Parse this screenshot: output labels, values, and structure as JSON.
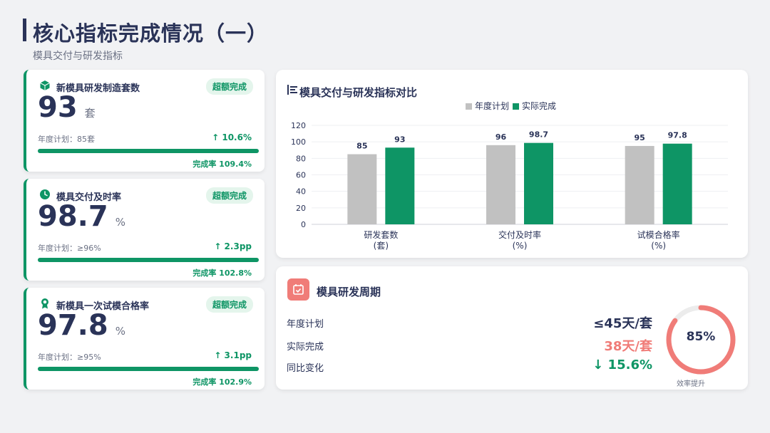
{
  "page": {
    "title": "核心指标完成情况（一）",
    "subtitle": "模具交付与研发指标"
  },
  "colors": {
    "primary": "#2a3358",
    "green": "#0e9565",
    "gray_bar": "#c1c1c1",
    "red": "#f07c78"
  },
  "kpi_cards": [
    {
      "icon": "cube-icon",
      "label": "新模具研发制造套数",
      "badge": "超额完成",
      "value": "93",
      "unit": "套",
      "plan": "年度计划：85套",
      "change": "↑ 10.6%",
      "rate_label": "完成率 109.4%",
      "progress": 1.0
    },
    {
      "icon": "clock-icon",
      "label": "模具交付及时率",
      "badge": "超额完成",
      "value": "98.7",
      "unit": "%",
      "plan": "年度计划：≥96%",
      "change": "↑ 2.3pp",
      "rate_label": "完成率 102.8%",
      "progress": 1.0
    },
    {
      "icon": "award-icon",
      "label": "新模具一次试模合格率",
      "badge": "超额完成",
      "value": "97.8",
      "unit": "%",
      "plan": "年度计划：≥95%",
      "change": "↑ 3.1pp",
      "rate_label": "完成率 102.9%",
      "progress": 1.0
    }
  ],
  "chart_data": {
    "type": "bar",
    "title": "模具交付与研发指标对比",
    "categories": [
      [
        "研发套数",
        "(套)"
      ],
      [
        "交付及时率",
        "(%)"
      ],
      [
        "试模合格率",
        "(%)"
      ]
    ],
    "series": [
      {
        "name": "年度计划",
        "values": [
          85,
          96,
          95
        ],
        "color": "#c1c1c1"
      },
      {
        "name": "实际完成",
        "values": [
          93,
          98.7,
          97.8
        ],
        "color": "#0e9565"
      }
    ],
    "value_labels": [
      [
        "85",
        "96",
        "95"
      ],
      [
        "93",
        "98.7",
        "97.8"
      ]
    ],
    "ylim": [
      0,
      120
    ],
    "yticks": [
      0,
      20,
      40,
      60,
      80,
      100,
      120
    ],
    "grid": true,
    "legend": "top-center"
  },
  "cycle": {
    "title": "模具研发周期",
    "rows": [
      {
        "label": "年度计划",
        "value": "≤45天/套",
        "color": "#2a3358"
      },
      {
        "label": "实际完成",
        "value": "38天/套",
        "color": "#f07c78"
      },
      {
        "label": "同比变化",
        "value": "↓ 15.6%",
        "color": "#0e9565"
      }
    ],
    "ring_percent": "85%",
    "ring_fraction": 0.85,
    "ring_caption": "效率提升"
  }
}
